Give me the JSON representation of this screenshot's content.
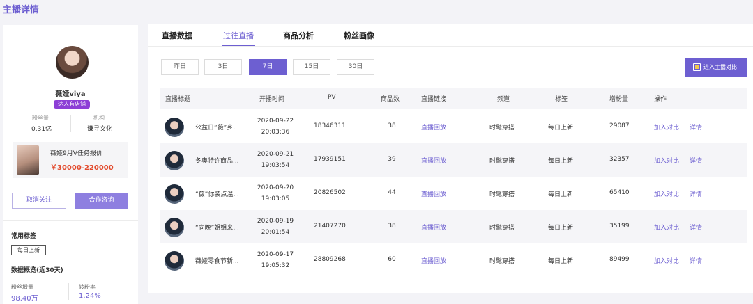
{
  "page": {
    "title": "主播详情"
  },
  "profile": {
    "name": "薇娅viya",
    "badge": "达人有店铺",
    "stats": [
      {
        "label": "粉丝量",
        "value": "0.31亿"
      },
      {
        "label": "机构",
        "value": "谦寻文化"
      }
    ],
    "promo": {
      "title": "薇娅9月V任务报价",
      "price": "￥30000-220000"
    },
    "unfollow_label": "取消关注",
    "contact_label": "合作咨询",
    "tags_title": "常用标签",
    "tags": [
      "每日上新"
    ],
    "overview_title": "数据概览(近30天)",
    "metrics": [
      {
        "label": "粉丝增量",
        "value": "98.40万"
      },
      {
        "label": "转粉率",
        "value": "1.24%"
      }
    ]
  },
  "tabs": [
    {
      "label": "直播数据",
      "active": false
    },
    {
      "label": "过往直播",
      "active": true
    },
    {
      "label": "商品分析",
      "active": false
    },
    {
      "label": "粉丝画像",
      "active": false
    }
  ],
  "ranges": [
    {
      "label": "昨日",
      "active": false
    },
    {
      "label": "3日",
      "active": false
    },
    {
      "label": "7日",
      "active": true
    },
    {
      "label": "15日",
      "active": false
    },
    {
      "label": "30日",
      "active": false
    }
  ],
  "compare_label": "进入主播对比",
  "table": {
    "headers": [
      "直播标题",
      "开播时间",
      "PV",
      "商品数",
      "直播链接",
      "频道",
      "标签",
      "增粉量",
      "操作"
    ],
    "rows": [
      {
        "title": "公益日“薇”乡...",
        "date": "2020-09-22",
        "time": "20:03:36",
        "pv": "18346311",
        "count": "38",
        "link": "直播回放",
        "channel": "时髦穿搭",
        "tag": "每日上新",
        "fans": "29087",
        "action_compare": "加入对比",
        "action_detail": "详情"
      },
      {
        "title": "冬奥特许商品...",
        "date": "2020-09-21",
        "time": "19:03:54",
        "pv": "17939151",
        "count": "39",
        "link": "直播回放",
        "channel": "时髦穿搭",
        "tag": "每日上新",
        "fans": "32357",
        "action_compare": "加入对比",
        "action_detail": "详情"
      },
      {
        "title": "“薇”你装点温...",
        "date": "2020-09-20",
        "time": "19:03:05",
        "pv": "20826502",
        "count": "44",
        "link": "直播回放",
        "channel": "时髦穿搭",
        "tag": "每日上新",
        "fans": "65410",
        "action_compare": "加入对比",
        "action_detail": "详情"
      },
      {
        "title": "“向晚”姐姐来...",
        "date": "2020-09-19",
        "time": "20:01:54",
        "pv": "21407270",
        "count": "38",
        "link": "直播回放",
        "channel": "时髦穿搭",
        "tag": "每日上新",
        "fans": "35199",
        "action_compare": "加入对比",
        "action_detail": "详情"
      },
      {
        "title": "薇娅零食节新...",
        "date": "2020-09-17",
        "time": "19:05:32",
        "pv": "28809268",
        "count": "60",
        "link": "直播回放",
        "channel": "时髦穿搭",
        "tag": "每日上新",
        "fans": "89499",
        "action_compare": "加入对比",
        "action_detail": "详情"
      }
    ]
  }
}
